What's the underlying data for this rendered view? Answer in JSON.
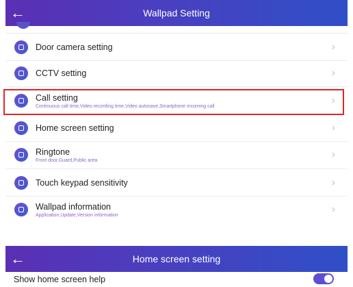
{
  "screen1": {
    "title": "Wallpad Setting",
    "back_icon": "arrow-left-icon",
    "items": [
      {
        "label": "Door camera setting",
        "icon": "door-camera-icon"
      },
      {
        "label": "CCTV setting",
        "icon": "cctv-icon"
      },
      {
        "label": "Call setting",
        "sub": "Continuous call time,Video recording time,Video autosave,Smartphone incoming call",
        "icon": "phone-icon"
      },
      {
        "label": "Home screen setting",
        "icon": "home-screen-icon"
      },
      {
        "label": "Ringtone",
        "sub": "Front door,Guard,Public area",
        "icon": "ringtone-icon"
      },
      {
        "label": "Touch keypad sensitivity",
        "icon": "touch-icon"
      },
      {
        "label": "Wallpad information",
        "sub": "Application,Update,Version information",
        "icon": "info-icon"
      }
    ],
    "chevron": "›"
  },
  "screen2": {
    "title": "Home screen setting",
    "back_icon": "arrow-left-icon",
    "help_label": "Show home screen help",
    "help_toggle_on": true
  },
  "colors": {
    "accent": "#5d4fd3",
    "highlight": "#e0252b",
    "header_start": "#5a2fb3",
    "header_end": "#2f4fc7"
  }
}
